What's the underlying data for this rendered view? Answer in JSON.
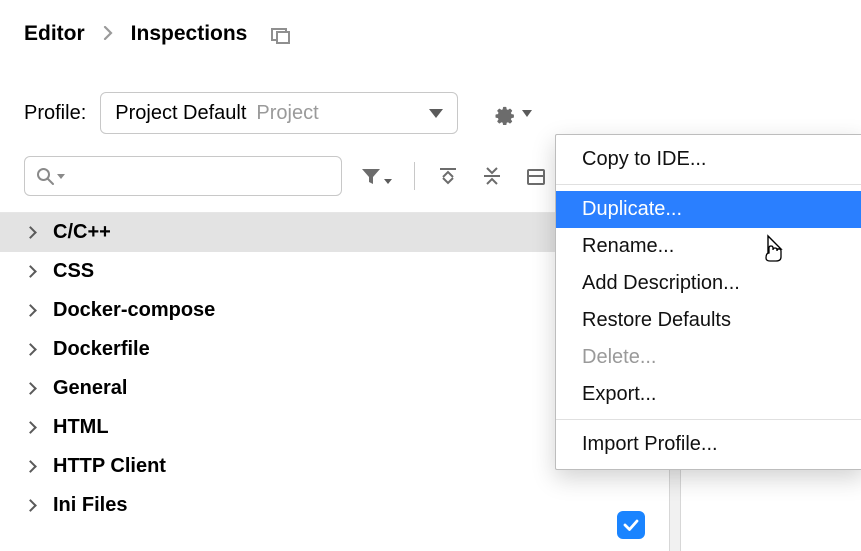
{
  "breadcrumb": {
    "parent": "Editor",
    "current": "Inspections"
  },
  "profile": {
    "label": "Profile:",
    "selected_name": "Project Default",
    "selected_scope": "Project"
  },
  "tree": {
    "items": [
      {
        "label": "C/C++",
        "selected": true
      },
      {
        "label": "CSS"
      },
      {
        "label": "Docker-compose"
      },
      {
        "label": "Dockerfile"
      },
      {
        "label": "General"
      },
      {
        "label": "HTML"
      },
      {
        "label": "HTTP Client"
      },
      {
        "label": "Ini Files"
      }
    ]
  },
  "popup": {
    "items": [
      {
        "label": "Copy to IDE...",
        "state": "normal"
      },
      {
        "sep": true
      },
      {
        "label": "Duplicate...",
        "state": "hover"
      },
      {
        "label": "Rename...",
        "state": "normal"
      },
      {
        "label": "Add Description...",
        "state": "normal"
      },
      {
        "label": "Restore Defaults",
        "state": "normal"
      },
      {
        "label": "Delete...",
        "state": "disabled"
      },
      {
        "label": "Export...",
        "state": "normal"
      },
      {
        "sep": true
      },
      {
        "label": "Import Profile...",
        "state": "normal"
      }
    ]
  }
}
